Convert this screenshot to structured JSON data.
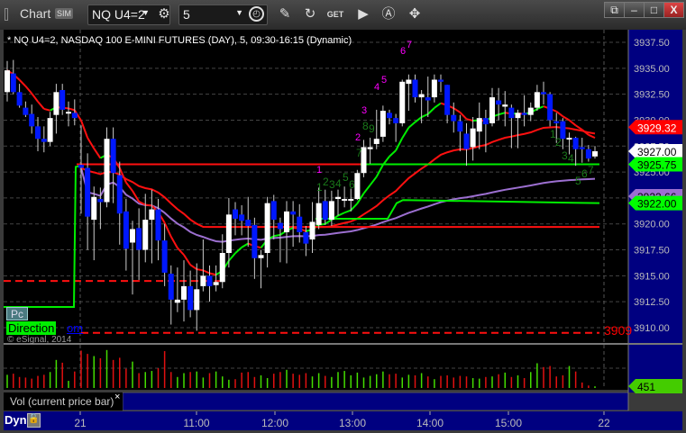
{
  "window": {
    "title": "Chart",
    "sim_badge": "SIM",
    "symbol": "NQ U4=2",
    "interval": "5",
    "icons": [
      "gear-icon",
      "clock-icon",
      "pencil-icon",
      "refresh-icon",
      "get-icon",
      "play-icon",
      "a-icon",
      "tools-icon"
    ],
    "controls": [
      "restore",
      "minimize",
      "maximize",
      "close"
    ],
    "close_label": "X"
  },
  "chart": {
    "title": "* NQ U4=2, NASDAQ 100 E-MINI FUTURES (DAY), 5, 09:30-16:15 (Dynamic)",
    "copyright": "© eSignal, 2014",
    "pc_label": "Pc",
    "direction_label": "Direction",
    "om_label": "om",
    "level_label": "3909"
  },
  "chart_data": {
    "type": "candlestick",
    "ylim": [
      3908.5,
      3939
    ],
    "yticks": [
      "3937.50",
      "3935.00",
      "3932.50",
      "3930.00",
      "3927.50",
      "3925.00",
      "3922.50",
      "3920.00",
      "3917.50",
      "3915.00",
      "3912.50",
      "3910.00"
    ],
    "xticks": [
      "21",
      "11:00",
      "12:00",
      "13:00",
      "14:00",
      "15:00",
      "22"
    ],
    "price_markers": [
      {
        "label": "3929.32",
        "value": 3929.32,
        "color": "#ff0000"
      },
      {
        "label": "3927.00",
        "value": 3927.0,
        "color": "#ffffff"
      },
      {
        "label": "3925.75",
        "value": 3925.75,
        "color": "#00ff00"
      },
      {
        "label": "3922.66",
        "value": 3922.66,
        "color": "#9c6fd0"
      },
      {
        "label": "3922.00",
        "value": 3922.0,
        "color": "#00ff00"
      }
    ],
    "levels": [
      {
        "value": 3925.75,
        "color": "#ff0000"
      },
      {
        "value": 3919.7,
        "color": "#ff0000"
      },
      {
        "value": 3914.5,
        "color": "#ff0000",
        "dashed": true
      },
      {
        "value": 3909.5,
        "color": "#ff0000",
        "dashed": true
      }
    ],
    "prev_day_candles": [
      [
        3932.7,
        3935.7,
        3931.8,
        3934.8
      ],
      [
        3934.5,
        3935.8,
        3932.5,
        3932.7
      ],
      [
        3932.7,
        3933.5,
        3931.2,
        3931.4
      ],
      [
        3931.2,
        3931.8,
        3930.3,
        3930.5
      ],
      [
        3930.6,
        3931.5,
        3928.7,
        3929.4
      ],
      [
        3929.4,
        3930.3,
        3927.0,
        3928.2
      ],
      [
        3928.2,
        3929.4,
        3926.9,
        3927.9
      ],
      [
        3927.9,
        3930.8,
        3927.5,
        3930.2
      ],
      [
        3930.5,
        3933.5,
        3928.7,
        3932.7
      ],
      [
        3932.9,
        3933.5,
        3930.5,
        3931.0
      ],
      [
        3930.7,
        3931.8,
        3929.4,
        3930.8
      ],
      [
        3930.7,
        3932.0,
        3929.5,
        3930.2
      ]
    ],
    "candles": [
      [
        3925.7,
        3929.5,
        3921,
        3925.4
      ],
      [
        3925.4,
        3926.8,
        3917.5,
        3920.7
      ],
      [
        3920.4,
        3923.6,
        3916.5,
        3922.6
      ],
      [
        3922.4,
        3923.5,
        3919.5,
        3922.1
      ],
      [
        3922.1,
        3929.3,
        3921.6,
        3928.2
      ],
      [
        3928.2,
        3929.3,
        3922,
        3924.9
      ],
      [
        3924.7,
        3926,
        3918,
        3921
      ],
      [
        3921.2,
        3922.4,
        3915.5,
        3917.6
      ],
      [
        3918.2,
        3920.3,
        3913.2,
        3919.5
      ],
      [
        3919.6,
        3921.5,
        3914.6,
        3917.5
      ],
      [
        3917.5,
        3922.9,
        3916.3,
        3920.4
      ],
      [
        3920.4,
        3923.3,
        3916.2,
        3921.4
      ],
      [
        3921.4,
        3922.4,
        3916.5,
        3918.4
      ],
      [
        3918.4,
        3920,
        3914,
        3915.3
      ],
      [
        3915.2,
        3916,
        3910.3,
        3912.7
      ],
      [
        3912.4,
        3915.8,
        3911.5,
        3912.7
      ],
      [
        3912.7,
        3916.5,
        3910.6,
        3914
      ],
      [
        3914,
        3915.5,
        3911,
        3911.7
      ],
      [
        3911.7,
        3916.2,
        3909.7,
        3913.7
      ],
      [
        3914,
        3918.5,
        3913.5,
        3915
      ],
      [
        3915,
        3916,
        3912.5,
        3914
      ],
      [
        3914.1,
        3916,
        3913.5,
        3914.4
      ],
      [
        3914.4,
        3919,
        3913.8,
        3917.2
      ],
      [
        3917.2,
        3922.5,
        3915.8,
        3920.9
      ],
      [
        3921.4,
        3922.1,
        3918.9,
        3920.5
      ],
      [
        3920.9,
        3921.8,
        3918.9,
        3920.3
      ],
      [
        3920.4,
        3922.6,
        3917.8,
        3919.8
      ],
      [
        3919.9,
        3920.6,
        3914.7,
        3916.7
      ],
      [
        3916.7,
        3917.5,
        3913.8,
        3917
      ],
      [
        3917.2,
        3922.6,
        3915.8,
        3922
      ],
      [
        3922.2,
        3922.8,
        3918.5,
        3920.4
      ],
      [
        3920.1,
        3920.6,
        3916.3,
        3919.5
      ],
      [
        3919.2,
        3922.2,
        3916.2,
        3921.2
      ],
      [
        3921.2,
        3922.2,
        3917.8,
        3920.9
      ],
      [
        3920.7,
        3921.9,
        3918.2,
        3919.2
      ],
      [
        3919.2,
        3919.8,
        3916.9,
        3918.1
      ],
      [
        3918.5,
        3922.1,
        3917.2,
        3920.2
      ],
      [
        3919.9,
        3923.5,
        3919.5,
        3922
      ],
      [
        3922.2,
        3923.3,
        3919.9,
        3920.4
      ],
      [
        3920.4,
        3923.2,
        3919.8,
        3922.2
      ],
      [
        3922.4,
        3923.3,
        3920.8,
        3922.6
      ],
      [
        3922.3,
        3923.6,
        3921.6,
        3922.4
      ],
      [
        3922.3,
        3923.4,
        3921.2,
        3922.4
      ],
      [
        3922.4,
        3925.2,
        3922.3,
        3924.9
      ],
      [
        3924.9,
        3928.1,
        3924.5,
        3927.4
      ],
      [
        3927.2,
        3928.3,
        3925.8,
        3927.4
      ],
      [
        3927.7,
        3931,
        3927.2,
        3928.2
      ],
      [
        3928.4,
        3931.4,
        3927.9,
        3930.9
      ],
      [
        3930.7,
        3931,
        3929.6,
        3930.2
      ],
      [
        3930.2,
        3930.6,
        3927.9,
        3929.7
      ],
      [
        3929.7,
        3933.9,
        3929.4,
        3933.7
      ],
      [
        3933.5,
        3934.4,
        3930.9,
        3933.9
      ],
      [
        3933.9,
        3934.4,
        3931.7,
        3932.2
      ],
      [
        3932.2,
        3932.9,
        3929.7,
        3932.5
      ],
      [
        3932.2,
        3934.2,
        3930.3,
        3931.9
      ],
      [
        3932.2,
        3934.4,
        3931.7,
        3933.9
      ],
      [
        3933.9,
        3934.4,
        3932.7,
        3933.7
      ],
      [
        3933.4,
        3933.4,
        3929.7,
        3930.5
      ],
      [
        3930.5,
        3931.7,
        3928.8,
        3929.9
      ],
      [
        3929.9,
        3930.5,
        3927,
        3928.9
      ],
      [
        3928.7,
        3929.7,
        3925.6,
        3927.2
      ],
      [
        3927.4,
        3930.3,
        3926.1,
        3929.2
      ],
      [
        3928.9,
        3931.7,
        3927.2,
        3930.2
      ],
      [
        3930.2,
        3931,
        3926.9,
        3929.6
      ],
      [
        3929.7,
        3933.1,
        3929.4,
        3932.2
      ],
      [
        3931.9,
        3933.1,
        3930,
        3931.5
      ],
      [
        3931.3,
        3932.8,
        3929.4,
        3931.5
      ],
      [
        3931.2,
        3931.5,
        3927.3,
        3930.2
      ],
      [
        3930.2,
        3931,
        3927.3,
        3930.7
      ],
      [
        3930.7,
        3932.4,
        3929.4,
        3930.5
      ],
      [
        3930.5,
        3931.7,
        3929.9,
        3931.2
      ],
      [
        3931.2,
        3933.4,
        3930.9,
        3932.7
      ],
      [
        3932.7,
        3933.7,
        3931.5,
        3932.5
      ],
      [
        3932.5,
        3932.7,
        3929.4,
        3930
      ],
      [
        3929.9,
        3930.7,
        3927.8,
        3929.7
      ],
      [
        3929.9,
        3930.2,
        3927.2,
        3928.2
      ],
      [
        3928.2,
        3928.8,
        3926.7,
        3928.3
      ],
      [
        3928.3,
        3928.4,
        3925.6,
        3927.2
      ],
      [
        3927.4,
        3928.3,
        3925.9,
        3927.2
      ],
      [
        3927.2,
        3927.6,
        3926,
        3926.3
      ],
      [
        3926.5,
        3927.5,
        3926.3,
        3927
      ]
    ],
    "volume": {
      "label": "Vol (current price bar)",
      "current": 451,
      "current_label": "451",
      "values": [
        2400,
        2600,
        2000,
        1900,
        1700,
        2200,
        2400,
        2900,
        5100,
        4600,
        1300,
        3000,
        6800,
        6200,
        5800,
        5400,
        6900,
        5100,
        5500,
        3500,
        4800,
        2700,
        2900,
        3100,
        3600,
        6700,
        2900,
        2000,
        2700,
        2900,
        3000,
        1900,
        2700,
        3000,
        2100,
        1500,
        1600,
        2800,
        2900,
        2000,
        2300,
        1800,
        2600,
        2900,
        3300,
        2600,
        2400,
        2700,
        2100,
        2700,
        2200,
        2000,
        2900,
        3100,
        2300,
        2800,
        1900,
        2200,
        2500,
        3000,
        2500,
        2600,
        1900,
        2400,
        2300,
        2700,
        2100,
        1600,
        2200,
        2300,
        1900,
        2200,
        2100,
        1800,
        1700,
        2000,
        2100,
        2500,
        2800,
        2000,
        2300,
        1800,
        2900,
        4500,
        3800,
        4000,
        2100,
        2300,
        4000,
        3000,
        1000,
        451,
        300
      ]
    },
    "annotations": {
      "magenta": [
        "1",
        "2",
        "3",
        "4",
        "5",
        "6",
        "7"
      ],
      "green_mid": [
        "1",
        "2",
        "3",
        "4",
        "5",
        "6",
        "7",
        "8",
        "9"
      ],
      "green_right": [
        "1",
        "2",
        "3",
        "4",
        "5",
        "6",
        "7"
      ]
    }
  },
  "footer": {
    "dyn_label": "Dyn"
  }
}
